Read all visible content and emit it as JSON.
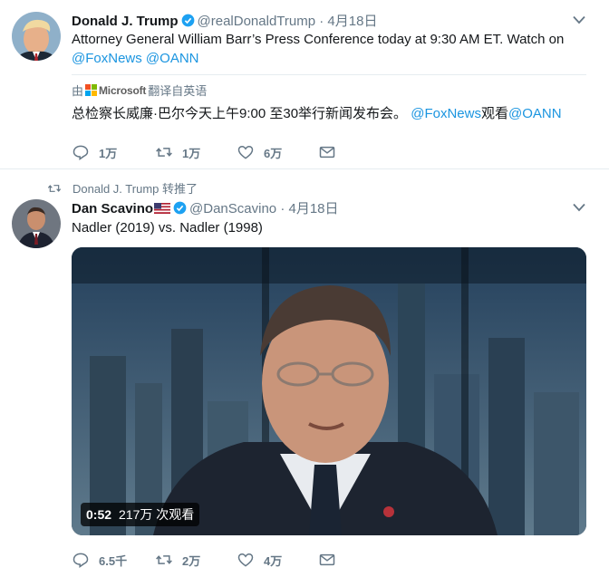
{
  "tweets": [
    {
      "name": "Donald J. Trump",
      "handle": "@realDonaldTrump",
      "separator": "·",
      "date": "4月18日",
      "text_line1": "Attorney General William Barr’s Press Conference today at 9:30 AM ET. Watch on",
      "mention1": "@FoxNews",
      "mention2": "@OANN",
      "translation_prefix": "由",
      "translation_brand": "Microsoft",
      "translation_suffix": "翻译自英语",
      "translated_text": "总检察长威廉·巴尔今天上午9:00 至30举行新闻发布会。",
      "translated_mention1": "@FoxNews",
      "translated_watch": "观看",
      "translated_mention2": "@OANN",
      "actions": {
        "reply": "1万",
        "retweet": "1万",
        "like": "6万",
        "message": ""
      }
    },
    {
      "retweeted_by": "Donald J. Trump 转推了",
      "name": "Dan Scavino",
      "handle": "@DanScavino",
      "separator": "·",
      "date": "4月18日",
      "text": "Nadler (2019) vs. Nadler (1998)",
      "video": {
        "duration": "0:52",
        "views": "217万 次观看"
      },
      "actions": {
        "reply": "6.5千",
        "retweet": "2万",
        "like": "4万",
        "message": ""
      }
    }
  ],
  "colors": {
    "accent": "#1b95e0",
    "muted": "#657786",
    "text": "#14171a",
    "border": "#e6ecf0"
  },
  "icons": [
    "verified-icon",
    "caret-down-icon",
    "reply-icon",
    "retweet-icon",
    "like-icon",
    "message-icon",
    "microsoft-logo",
    "us-flag-icon"
  ]
}
